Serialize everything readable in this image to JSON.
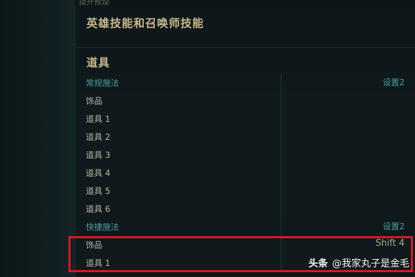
{
  "top_strip_text": "提升预设",
  "sections": {
    "skills_title": "英雄技能和召唤师技能",
    "items_title": "道具"
  },
  "rows": [
    {
      "name": "常规施法",
      "value": "设置2",
      "header": true
    },
    {
      "name": "饰品",
      "value": ""
    },
    {
      "name": "道具 1",
      "value": ""
    },
    {
      "name": "道具 2",
      "value": ""
    },
    {
      "name": "道具 3",
      "value": ""
    },
    {
      "name": "道具 4",
      "value": ""
    },
    {
      "name": "道具 5",
      "value": ""
    },
    {
      "name": "道具 6",
      "value": ""
    },
    {
      "name": "快捷施法",
      "value": "设置2",
      "header": true
    },
    {
      "name": "饰品",
      "value": "Shift  4"
    },
    {
      "name": "道具 1",
      "value": ""
    }
  ],
  "watermark": {
    "logo": "头条",
    "text": "@我家丸子是金毛"
  },
  "colors": {
    "highlight": "#e0161b",
    "header_text": "#4f9aa0",
    "title_text": "#c9b98a"
  }
}
